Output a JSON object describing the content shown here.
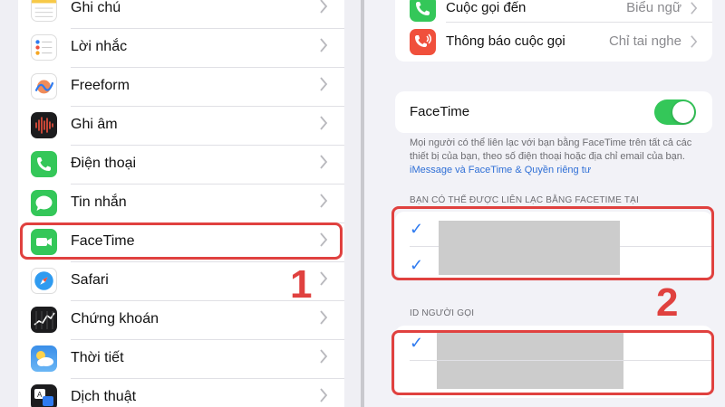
{
  "left_panel": {
    "items": [
      {
        "label": "Ghi chú",
        "icon": "notes-icon"
      },
      {
        "label": "Lời nhắc",
        "icon": "reminders-icon"
      },
      {
        "label": "Freeform",
        "icon": "freeform-icon"
      },
      {
        "label": "Ghi âm",
        "icon": "voice-memos-icon"
      },
      {
        "label": "Điện thoại",
        "icon": "phone-icon"
      },
      {
        "label": "Tin nhắn",
        "icon": "messages-icon"
      },
      {
        "label": "FaceTime",
        "icon": "facetime-icon"
      },
      {
        "label": "Safari",
        "icon": "safari-icon"
      },
      {
        "label": "Chứng khoán",
        "icon": "stocks-icon"
      },
      {
        "label": "Thời tiết",
        "icon": "weather-icon"
      },
      {
        "label": "Dịch thuật",
        "icon": "translate-icon"
      }
    ],
    "step_number": "1"
  },
  "right_panel": {
    "top_rows": [
      {
        "label": "Cuộc gọi đến",
        "value": "Biểu ngữ",
        "icon": "incoming-call-icon"
      },
      {
        "label": "Thông báo cuộc gọi",
        "value": "Chỉ tai nghe",
        "icon": "announce-calls-icon"
      }
    ],
    "facetime_toggle": {
      "label": "FaceTime",
      "on": true
    },
    "description": "Mọi người có thể liên lạc với bạn bằng FaceTime trên tất cả các thiết bị của bạn, theo số điện thoại hoặc địa chỉ email của bạn.",
    "description_link": "iMessage và FaceTime & Quyền riêng tư",
    "reachable_header": "BẠN CÓ THỂ ĐƯỢC LIÊN LẠC BẰNG FACETIME TẠI",
    "caller_id_header": "ID NGƯỜI GỌI",
    "checkmark": "✓",
    "step_number": "2"
  },
  "colors": {
    "highlight": "#e0413f",
    "toggle_on": "#34c759",
    "link": "#2f6fd6"
  }
}
